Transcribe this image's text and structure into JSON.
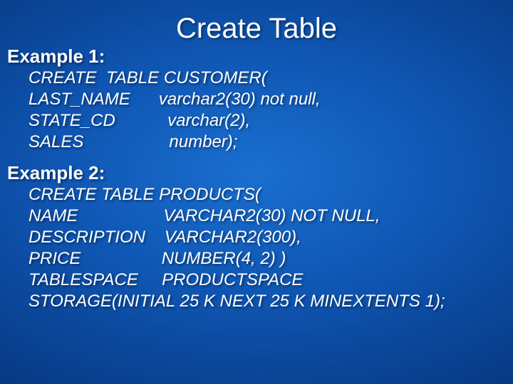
{
  "title": "Create Table",
  "ex1_label": "Example 1:",
  "ex1_line1": "CREATE  TABLE CUSTOMER(",
  "ex1_line2": "LAST_NAME      varchar2(30) not null,",
  "ex1_line3": "STATE_CD           varchar(2),",
  "ex1_line4": "SALES                  number);",
  "ex2_label": "Example 2:",
  "ex2_line1": "CREATE TABLE PRODUCTS(",
  "ex2_line2": "NAME                  VARCHAR2(30) NOT NULL,",
  "ex2_line3": "DESCRIPTION    VARCHAR2(300),",
  "ex2_line4": "PRICE                 NUMBER(4, 2) )",
  "ex2_line5": "TABLESPACE     PRODUCTSPACE",
  "ex2_line6": "STORAGE(INITIAL 25 K NEXT 25 K MINEXTENTS 1);"
}
